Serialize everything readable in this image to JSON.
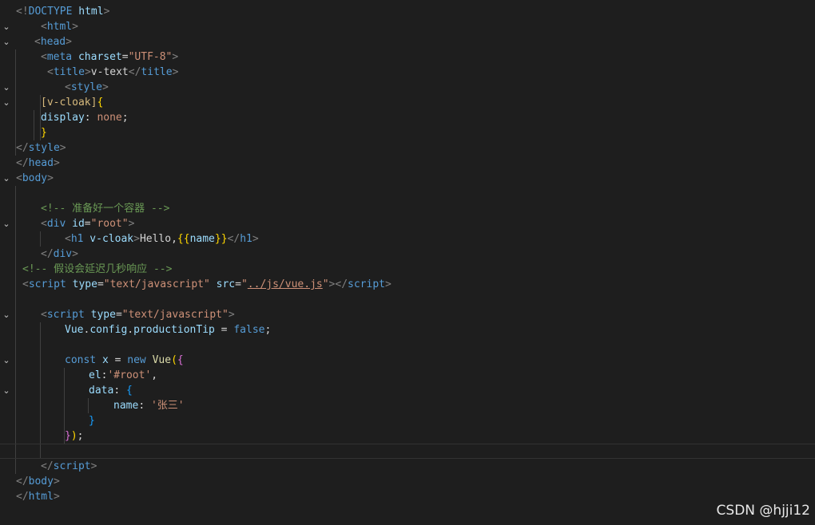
{
  "editor": {
    "theme_colors": {
      "background": "#1e1e1e",
      "tag": "#569cd6",
      "attribute": "#9cdcfe",
      "string": "#ce9178",
      "comment": "#6a9955",
      "selector": "#d7ba7d",
      "bracket_level_1": "#ffd700",
      "bracket_level_2": "#da70d6",
      "bracket_level_3": "#179fff"
    },
    "lines": [
      {
        "fold": "",
        "tokens": [
          {
            "t": "<!",
            "c": "punc"
          },
          {
            "t": "DOCTYPE",
            "c": "doctype"
          },
          {
            "t": " html",
            "c": "attr"
          },
          {
            "t": ">",
            "c": "punc"
          }
        ]
      },
      {
        "fold": "chevron-down",
        "tokens": [
          {
            "t": "<",
            "c": "punc"
          },
          {
            "t": "html",
            "c": "tag"
          },
          {
            "t": ">",
            "c": "punc"
          }
        ]
      },
      {
        "fold": "chevron-down",
        "tokens": [
          {
            "t": "<",
            "c": "punc"
          },
          {
            "t": "head",
            "c": "tag"
          },
          {
            "t": ">",
            "c": "punc"
          }
        ]
      },
      {
        "fold": "",
        "tokens": [
          {
            "t": "<",
            "c": "punc"
          },
          {
            "t": "meta",
            "c": "tag"
          },
          {
            "t": " charset",
            "c": "attr"
          },
          {
            "t": "=",
            "c": "text"
          },
          {
            "t": "\"UTF-8\"",
            "c": "str"
          },
          {
            "t": ">",
            "c": "punc"
          }
        ]
      },
      {
        "fold": "",
        "tokens": [
          {
            "t": "<",
            "c": "punc"
          },
          {
            "t": "title",
            "c": "tag"
          },
          {
            "t": ">",
            "c": "punc"
          },
          {
            "t": "v-text",
            "c": "text"
          },
          {
            "t": "</",
            "c": "punc"
          },
          {
            "t": "title",
            "c": "tag"
          },
          {
            "t": ">",
            "c": "punc"
          }
        ]
      },
      {
        "fold": "chevron-down",
        "tokens": [
          {
            "t": "<",
            "c": "punc"
          },
          {
            "t": "style",
            "c": "tag"
          },
          {
            "t": ">",
            "c": "punc"
          }
        ]
      },
      {
        "fold": "chevron-down",
        "tokens": [
          {
            "t": "[v-cloak]",
            "c": "selector"
          },
          {
            "t": "{",
            "c": "brace1"
          }
        ]
      },
      {
        "fold": "",
        "tokens": [
          {
            "t": "display",
            "c": "prop"
          },
          {
            "t": ": ",
            "c": "text"
          },
          {
            "t": "none",
            "c": "value"
          },
          {
            "t": ";",
            "c": "text"
          }
        ]
      },
      {
        "fold": "",
        "tokens": [
          {
            "t": "}",
            "c": "brace1"
          }
        ]
      },
      {
        "fold": "",
        "tokens": [
          {
            "t": "</",
            "c": "punc"
          },
          {
            "t": "style",
            "c": "tag"
          },
          {
            "t": ">",
            "c": "punc"
          }
        ]
      },
      {
        "fold": "",
        "tokens": [
          {
            "t": "</",
            "c": "punc"
          },
          {
            "t": "head",
            "c": "tag"
          },
          {
            "t": ">",
            "c": "punc"
          }
        ]
      },
      {
        "fold": "chevron-down",
        "tokens": [
          {
            "t": "<",
            "c": "punc"
          },
          {
            "t": "body",
            "c": "tag"
          },
          {
            "t": ">",
            "c": "punc"
          }
        ]
      },
      {
        "fold": "",
        "tokens": []
      },
      {
        "fold": "",
        "tokens": [
          {
            "t": "<!-- 准备好一个容器 -->",
            "c": "comment"
          }
        ]
      },
      {
        "fold": "chevron-down",
        "tokens": [
          {
            "t": "<",
            "c": "punc"
          },
          {
            "t": "div",
            "c": "tag"
          },
          {
            "t": " id",
            "c": "attr"
          },
          {
            "t": "=",
            "c": "text"
          },
          {
            "t": "\"root\"",
            "c": "str"
          },
          {
            "t": ">",
            "c": "punc"
          }
        ]
      },
      {
        "fold": "",
        "tokens": [
          {
            "t": "<",
            "c": "punc"
          },
          {
            "t": "h1",
            "c": "tag"
          },
          {
            "t": " v-cloak",
            "c": "attr"
          },
          {
            "t": ">",
            "c": "punc"
          },
          {
            "t": "Hello,",
            "c": "text"
          },
          {
            "t": "{{",
            "c": "brace1"
          },
          {
            "t": "name",
            "c": "var"
          },
          {
            "t": "}}",
            "c": "brace1"
          },
          {
            "t": "</",
            "c": "punc"
          },
          {
            "t": "h1",
            "c": "tag"
          },
          {
            "t": ">",
            "c": "punc"
          }
        ]
      },
      {
        "fold": "",
        "tokens": [
          {
            "t": "</",
            "c": "punc"
          },
          {
            "t": "div",
            "c": "tag"
          },
          {
            "t": ">",
            "c": "punc"
          }
        ]
      },
      {
        "fold": "",
        "tokens": [
          {
            "t": "<!-- 假设会延迟几秒响应 -->",
            "c": "comment"
          }
        ]
      },
      {
        "fold": "",
        "tokens": [
          {
            "t": "<",
            "c": "punc"
          },
          {
            "t": "script",
            "c": "tag"
          },
          {
            "t": " type",
            "c": "attr"
          },
          {
            "t": "=",
            "c": "text"
          },
          {
            "t": "\"text/javascript\"",
            "c": "str"
          },
          {
            "t": " src",
            "c": "attr"
          },
          {
            "t": "=",
            "c": "text"
          },
          {
            "t": "\"",
            "c": "str"
          },
          {
            "t": "../js/vue.js",
            "c": "str underline"
          },
          {
            "t": "\"",
            "c": "str"
          },
          {
            "t": "></",
            "c": "punc"
          },
          {
            "t": "script",
            "c": "tag"
          },
          {
            "t": ">",
            "c": "punc"
          }
        ]
      },
      {
        "fold": "",
        "tokens": []
      },
      {
        "fold": "chevron-down",
        "tokens": [
          {
            "t": "<",
            "c": "punc"
          },
          {
            "t": "script",
            "c": "tag"
          },
          {
            "t": " type",
            "c": "attr"
          },
          {
            "t": "=",
            "c": "text"
          },
          {
            "t": "\"text/javascript\"",
            "c": "str"
          },
          {
            "t": ">",
            "c": "punc"
          }
        ]
      },
      {
        "fold": "",
        "tokens": [
          {
            "t": "Vue",
            "c": "var"
          },
          {
            "t": ".",
            "c": "text"
          },
          {
            "t": "config",
            "c": "var"
          },
          {
            "t": ".",
            "c": "text"
          },
          {
            "t": "productionTip",
            "c": "var"
          },
          {
            "t": " = ",
            "c": "text"
          },
          {
            "t": "false",
            "c": "keyword"
          },
          {
            "t": ";",
            "c": "text"
          }
        ]
      },
      {
        "fold": "",
        "tokens": []
      },
      {
        "fold": "chevron-down",
        "tokens": [
          {
            "t": "const",
            "c": "keyword"
          },
          {
            "t": " x",
            "c": "var"
          },
          {
            "t": " = ",
            "c": "text"
          },
          {
            "t": "new",
            "c": "keyword"
          },
          {
            "t": " ",
            "c": "text"
          },
          {
            "t": "Vue",
            "c": "fn"
          },
          {
            "t": "(",
            "c": "brace1"
          },
          {
            "t": "{",
            "c": "brace2"
          }
        ]
      },
      {
        "fold": "",
        "tokens": [
          {
            "t": "el",
            "c": "var"
          },
          {
            "t": ":",
            "c": "text"
          },
          {
            "t": "'#root'",
            "c": "str"
          },
          {
            "t": ",",
            "c": "text"
          }
        ]
      },
      {
        "fold": "chevron-down",
        "tokens": [
          {
            "t": "data",
            "c": "var"
          },
          {
            "t": ": ",
            "c": "text"
          },
          {
            "t": "{",
            "c": "brace3"
          }
        ]
      },
      {
        "fold": "",
        "tokens": [
          {
            "t": "name",
            "c": "var"
          },
          {
            "t": ": ",
            "c": "text"
          },
          {
            "t": "'张三'",
            "c": "str"
          }
        ]
      },
      {
        "fold": "",
        "tokens": [
          {
            "t": "}",
            "c": "brace3"
          }
        ]
      },
      {
        "fold": "",
        "tokens": [
          {
            "t": "}",
            "c": "brace2"
          },
          {
            "t": ")",
            "c": "brace1"
          },
          {
            "t": ";",
            "c": "text"
          }
        ]
      },
      {
        "fold": "",
        "tokens": []
      },
      {
        "fold": "",
        "tokens": [
          {
            "t": "</",
            "c": "punc"
          },
          {
            "t": "script",
            "c": "tag"
          },
          {
            "t": ">",
            "c": "punc"
          }
        ]
      },
      {
        "fold": "",
        "tokens": [
          {
            "t": "</",
            "c": "punc"
          },
          {
            "t": "body",
            "c": "tag"
          },
          {
            "t": ">",
            "c": "punc"
          }
        ]
      },
      {
        "fold": "",
        "tokens": [
          {
            "t": "</",
            "c": "punc"
          },
          {
            "t": "html",
            "c": "tag"
          },
          {
            "t": ">",
            "c": "punc"
          }
        ]
      }
    ]
  },
  "watermark": {
    "text": "CSDN @hjji12"
  }
}
